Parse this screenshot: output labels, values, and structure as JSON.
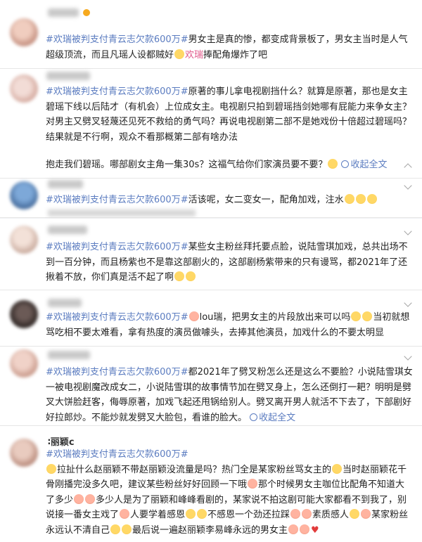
{
  "hashtag": "#欢瑞被判支付青云志欠款600万#",
  "show_more": "收起全文",
  "arrow": "∧",
  "posts": [
    {
      "segments": [
        {
          "t": "男女主是真的惨，都变成背景板了，男女主当时是人气超级顶流，而且凡瑶人设都贼好",
          "c": ""
        },
        {
          "t": "欢瑞",
          "c": "em"
        },
        {
          "t": "捧配角爆炸了吧",
          "c": ""
        }
      ]
    },
    {
      "segments": [
        {
          "t": "原著的事儿拿电视剧挡什么？就算是原著，那也是女主碧瑶下线以后陆才（有机会）上位成女主。电视剧只拍到碧瑶挡剑她哪有屁能力来争女主？对男主又劈叉轻蔑还见死不救给的勇气吗？再说电视剧第二部不是她戏份十倍超过碧瑶吗？结果就是不行啊，观众不看那概第二部有啥办法",
          "c": ""
        }
      ],
      "extra": "抱走我们碧瑶。哪部剧女主角一集30s？这福气给你们家演员要不要？"
    },
    {
      "segments": [
        {
          "t": "活该呢，女二变女一，配角加戏，注水",
          "c": ""
        }
      ]
    },
    {
      "segments": [
        {
          "t": "某些女主粉丝拜托要点脸，说陆雪琪加戏，总共出场不到一百分钟，而且杨紫也不是靠这部剧火的，这部剧杨紫带来的只有谩骂，都2021年了还揪着不放，你们真是活不起了啊",
          "c": ""
        }
      ]
    },
    {
      "segments": [
        {
          "t": "lou瑞，把男女主的片段放出来可以吗",
          "c": ""
        },
        {
          "t": "当初就想骂吃相不要太难看，拿有热度的演员做噱头，去捧其他演员，加戏什么的不要太明显",
          "c": ""
        }
      ]
    },
    {
      "segments": [
        {
          "t": "都2021年了劈叉粉怎么还是这么不要脸？小说陆雪琪女一被电视剧魔改成女二，小说陆雪琪的故事情节加在劈叉身上，怎么还倒打一耙？明明是劈叉大饼脸赶客，侮辱原著，加戏飞起还甩锅给别人。劈叉离开男人就活不下去了，下部剧好好拉郎炒。不能炒就发劈叉大脸包，看谁的脸大。",
          "c": ""
        }
      ]
    },
    {
      "name_visible": "∶丽颖c",
      "segments": [
        {
          "t": "拉扯什么赵丽颖不带赵丽颖没流量是吗？热门全是某家粉丝骂女主的",
          "c": ""
        },
        {
          "t": "当时赵丽颖花千骨刚播完没多久吧，建议某些粉丝好好回顾一下哦",
          "c": ""
        },
        {
          "t": "那个时候男女主咖位比配角不知道大了多少",
          "c": ""
        },
        {
          "t": "多少人是为了丽颖和峰峰看剧的，某家说不拍这剧可能大家都看不到我了，别说接一番女主戏了",
          "c": ""
        },
        {
          "t": "人要学着感恩",
          "c": ""
        },
        {
          "t": "不感恩一个劲还拉踩",
          "c": ""
        },
        {
          "t": "素质感人",
          "c": ""
        },
        {
          "t": "某家粉丝永远认不清自己",
          "c": ""
        },
        {
          "t": "最后说一遍赵丽颖李易峰永远的男女主",
          "c": ""
        }
      ]
    }
  ]
}
